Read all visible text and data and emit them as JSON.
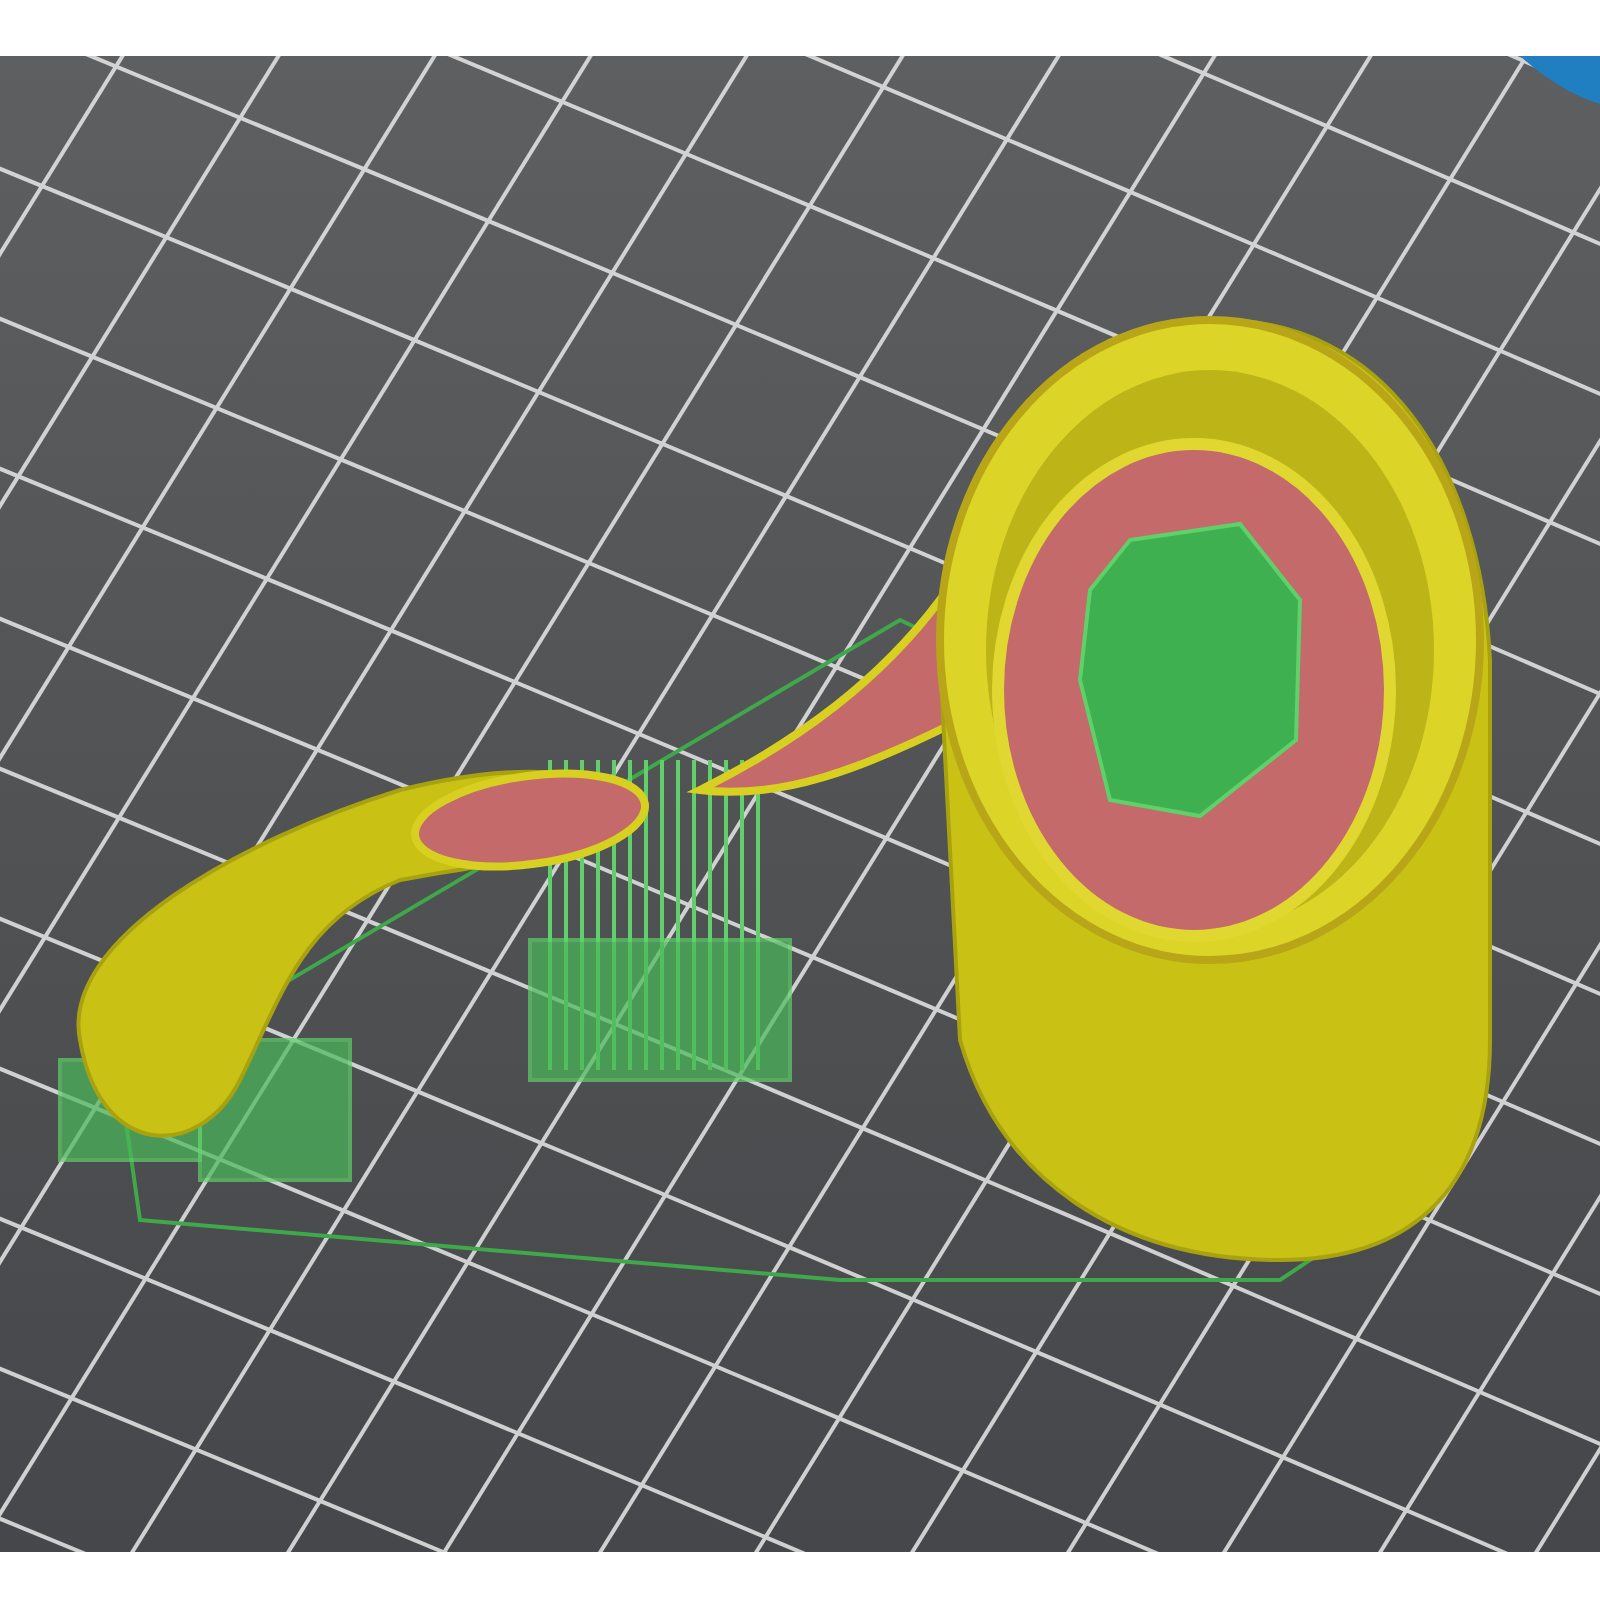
{
  "viewport": {
    "kind": "slice-preview"
  }
}
